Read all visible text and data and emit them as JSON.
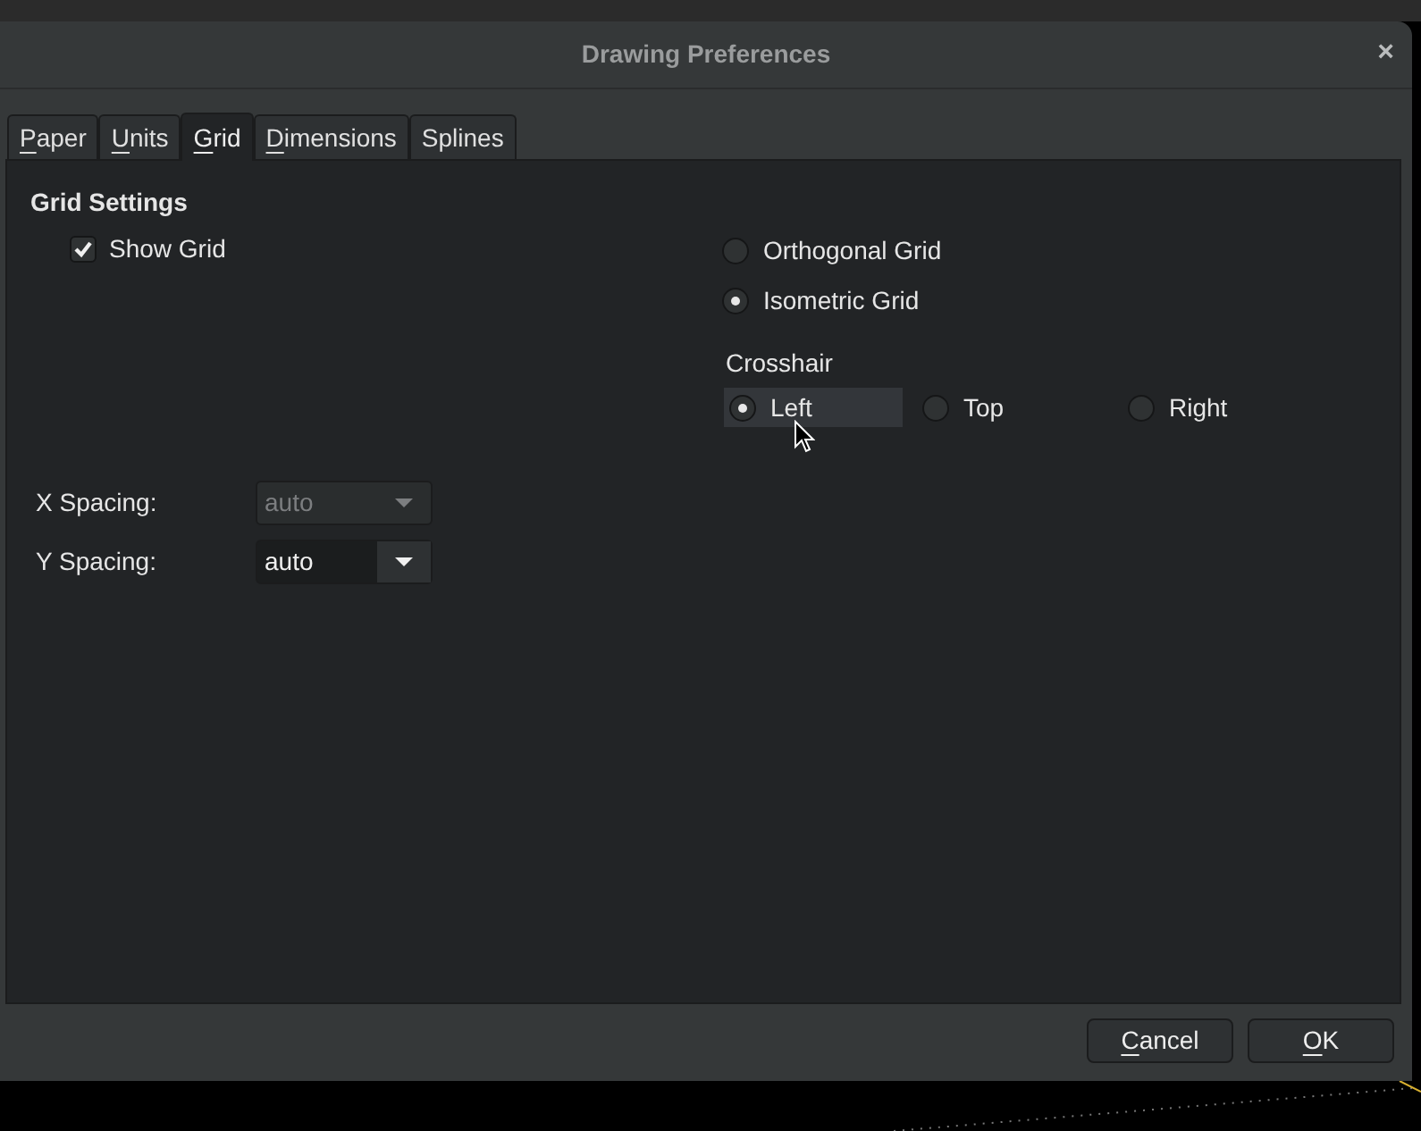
{
  "dialog": {
    "title": "Drawing Preferences",
    "close": "×"
  },
  "tabs": [
    {
      "label": "Paper",
      "mnemonic": true,
      "selected": false
    },
    {
      "label": "Units",
      "mnemonic": true,
      "selected": false
    },
    {
      "label": "Grid",
      "mnemonic": true,
      "selected": true
    },
    {
      "label": "Dimensions",
      "mnemonic": true,
      "selected": false
    },
    {
      "label": "Splines",
      "mnemonic": false,
      "selected": false
    }
  ],
  "grid_settings": {
    "heading": "Grid Settings",
    "show_grid": {
      "label": "Show Grid",
      "checked": true
    },
    "grid_types": [
      {
        "label": "Orthogonal Grid",
        "selected": false
      },
      {
        "label": "Isometric Grid",
        "selected": true
      }
    ],
    "crosshair": {
      "label": "Crosshair",
      "options": [
        {
          "label": "Left",
          "selected": true,
          "hovered": true
        },
        {
          "label": "Top",
          "selected": false,
          "hovered": false
        },
        {
          "label": "Right",
          "selected": false,
          "hovered": false
        }
      ]
    },
    "spacing": [
      {
        "label": "X Spacing:",
        "value": "auto",
        "disabled": true
      },
      {
        "label": "Y Spacing:",
        "value": "auto",
        "disabled": false
      }
    ]
  },
  "buttons": [
    {
      "label": "Cancel",
      "mnemonic": true
    },
    {
      "label": "OK",
      "mnemonic": true
    }
  ]
}
